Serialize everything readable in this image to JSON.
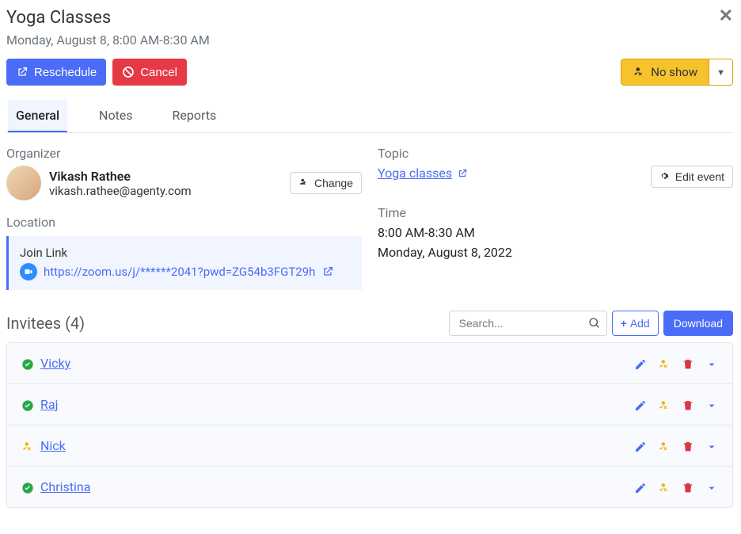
{
  "header": {
    "title": "Yoga Classes",
    "datetime": "Monday, August 8, 8:00 AM-8:30 AM"
  },
  "actions": {
    "reschedule": "Reschedule",
    "cancel": "Cancel",
    "noshow": "No show"
  },
  "tabs": {
    "general": "General",
    "notes": "Notes",
    "reports": "Reports"
  },
  "organizer": {
    "label": "Organizer",
    "name": "Vikash Rathee",
    "email": "vikash.rathee@agenty.com",
    "change": "Change"
  },
  "location": {
    "label": "Location",
    "join_label": "Join Link",
    "url": "https://zoom.us/j/******2041?pwd=ZG54b3FGT29h"
  },
  "topic": {
    "label": "Topic",
    "name": "Yoga classes",
    "edit": "Edit event"
  },
  "time": {
    "label": "Time",
    "range": "8:00 AM-8:30 AM",
    "date": "Monday, August 8, 2022"
  },
  "invitees": {
    "title": "Invitees (4)",
    "search_placeholder": "Search...",
    "add": "Add",
    "download": "Download",
    "list": [
      {
        "name": "Vicky",
        "status": "confirmed"
      },
      {
        "name": "Raj",
        "status": "confirmed"
      },
      {
        "name": "Nick",
        "status": "noshow"
      },
      {
        "name": "Christina",
        "status": "confirmed"
      }
    ]
  }
}
